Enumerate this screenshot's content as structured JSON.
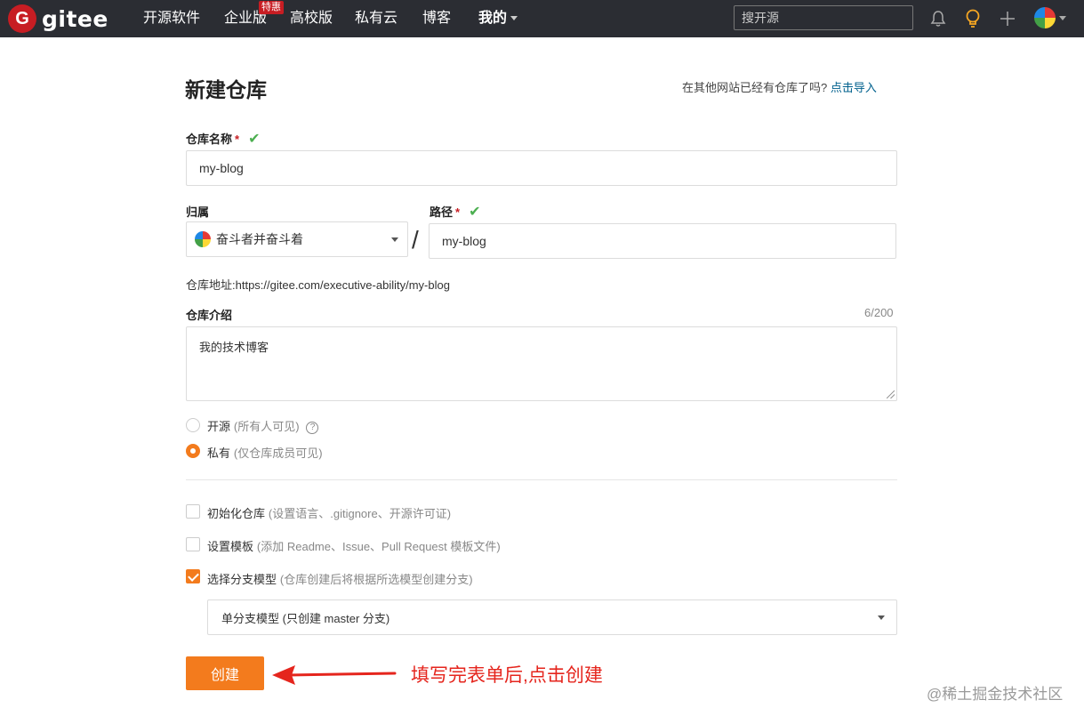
{
  "header": {
    "brand": "G",
    "brand_text": "gitee",
    "nav": [
      "开源软件",
      "企业版",
      "高校版",
      "私有云",
      "博客",
      "我的"
    ],
    "enterprise_badge": "特惠",
    "search_placeholder": "搜开源"
  },
  "page": {
    "title": "新建仓库",
    "import_hint": "在其他网站已经有仓库了吗?",
    "import_link": "点击导入"
  },
  "form": {
    "repo_name_label": "仓库名称",
    "required_mark": "*",
    "repo_name_value": "my-blog",
    "owner_label": "归属",
    "owner_value": "奋斗者并奋斗着",
    "slash": "/",
    "path_label": "路径",
    "path_value": "my-blog",
    "repo_url_text": "仓库地址:https://gitee.com/executive-ability/my-blog",
    "desc_label": "仓库介绍",
    "desc_counter": "6/200",
    "desc_value": "我的技术博客",
    "visibility": {
      "public_label": "开源",
      "public_sub": "(所有人可见)",
      "private_label": "私有",
      "private_sub": "(仅仓库成员可见)",
      "selected": "private"
    },
    "options": {
      "init_label": "初始化仓库",
      "init_sub": "(设置语言、.gitignore、开源许可证)",
      "init_checked": false,
      "template_label": "设置模板",
      "template_sub": "(添加 Readme、Issue、Pull Request 模板文件)",
      "template_checked": false,
      "branch_label": "选择分支模型",
      "branch_sub": "(仓库创建后将根据所选模型创建分支)",
      "branch_checked": true,
      "branch_model_value": "单分支模型 (只创建 master 分支)"
    },
    "create_button": "创建"
  },
  "annotation": {
    "text": "填写完表单后,点击创建",
    "color": "#e5251d"
  },
  "watermark": "@稀土掘金技术社区",
  "colors": {
    "accent": "#f37b1d",
    "header_bg": "#2b2d33",
    "brand_red": "#c71d23",
    "valid_green": "#4caf50",
    "link": "#00608d"
  }
}
